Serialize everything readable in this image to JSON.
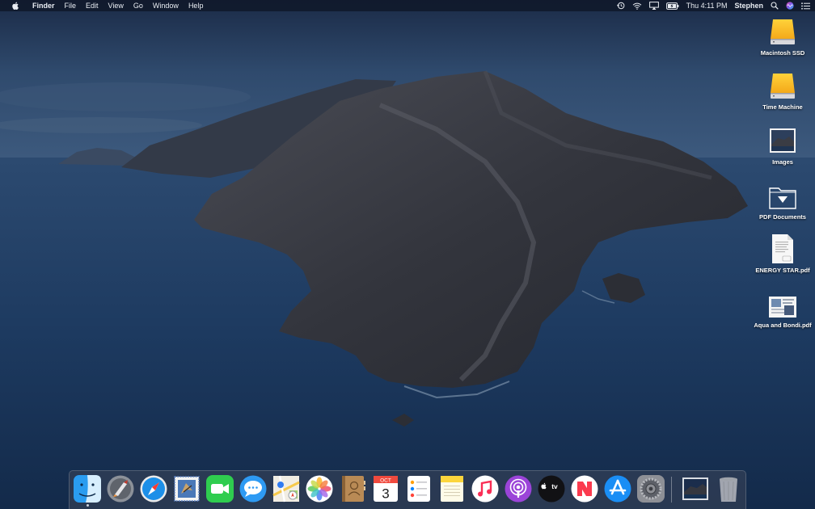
{
  "menubar": {
    "app_name": "Finder",
    "menus": [
      "File",
      "Edit",
      "View",
      "Go",
      "Window",
      "Help"
    ],
    "clock": "Thu 4:11 PM",
    "user": "Stephen",
    "status_icons": [
      "time-machine-icon",
      "wifi-icon",
      "airplay-icon",
      "battery-icon",
      "spotlight-icon",
      "siri-icon",
      "notification-center-icon"
    ]
  },
  "desktop": {
    "icons": [
      {
        "label": "Macintosh SSD",
        "icon": "hard-drive-icon"
      },
      {
        "label": "Time Machine",
        "icon": "hard-drive-icon"
      },
      {
        "label": "Images",
        "icon": "image-icon"
      },
      {
        "label": "PDF Documents",
        "icon": "folder-icon"
      },
      {
        "label": "ENERGY STAR.pdf",
        "icon": "pdf-document-icon"
      },
      {
        "label": "Aqua and Bondi.pdf",
        "icon": "pdf-preview-icon"
      }
    ]
  },
  "dock": {
    "apps": [
      {
        "name": "Finder",
        "running": true
      },
      {
        "name": "Launchpad"
      },
      {
        "name": "Safari"
      },
      {
        "name": "Mail"
      },
      {
        "name": "FaceTime"
      },
      {
        "name": "Messages"
      },
      {
        "name": "Maps"
      },
      {
        "name": "Photos"
      },
      {
        "name": "Contacts"
      },
      {
        "name": "Calendar",
        "month": "OCT",
        "day": "3"
      },
      {
        "name": "Reminders"
      },
      {
        "name": "Notes"
      },
      {
        "name": "Music"
      },
      {
        "name": "Podcasts"
      },
      {
        "name": "TV",
        "badge_text": "tv"
      },
      {
        "name": "News"
      },
      {
        "name": "App Store"
      },
      {
        "name": "System Preferences"
      }
    ],
    "extras": [
      {
        "name": "Downloads stack"
      },
      {
        "name": "Trash"
      }
    ]
  },
  "colors": {
    "menubar_bg": "#0e1626",
    "sea": "#1d3a60",
    "sky": "#2b4466"
  }
}
